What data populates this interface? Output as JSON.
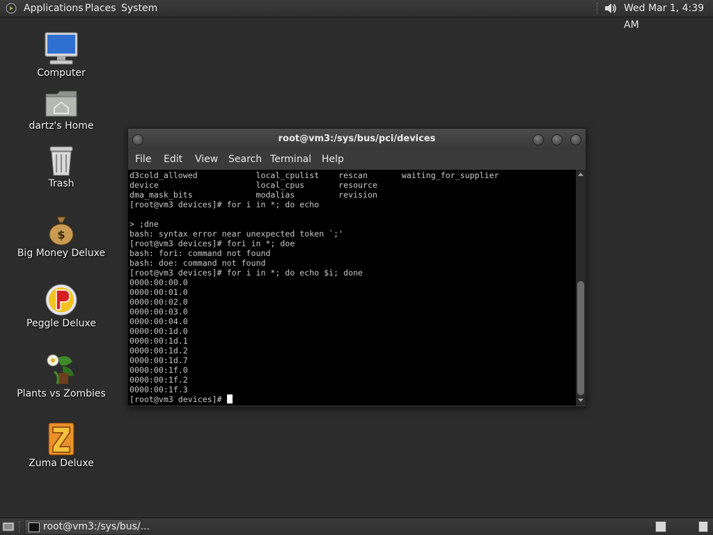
{
  "top_panel": {
    "applications_label": "Applications",
    "places_label": "Places",
    "system_label": "System",
    "clock": "Wed Mar 1,  4:39 AM"
  },
  "desktop": {
    "icons": [
      {
        "label": "Computer",
        "icon": "computer-icon"
      },
      {
        "label": "dartz's Home",
        "icon": "home-folder-icon"
      },
      {
        "label": "Trash",
        "icon": "trash-icon"
      },
      {
        "label": "Big Money Deluxe",
        "icon": "money-bag-icon"
      },
      {
        "label": "Peggle Deluxe",
        "icon": "peggle-icon"
      },
      {
        "label": "Plants vs Zombies",
        "icon": "plants-vs-zombies-icon"
      },
      {
        "label": "Zuma Deluxe",
        "icon": "zuma-icon"
      }
    ]
  },
  "terminal": {
    "title": "root@vm3:/sys/bus/pci/devices",
    "menu": {
      "file": "File",
      "edit": "Edit",
      "view": "View",
      "search": "Search",
      "terminal": "Terminal",
      "help": "Help"
    },
    "lines": [
      "d3cold_allowed            local_cpulist    rescan       waiting_for_supplier",
      "device                    local_cpus       resource",
      "dma_mask_bits             modalias         revision",
      "[root@vm3 devices]# for i in *; do echo",
      "",
      "> ;dne",
      "bash: syntax error near unexpected token `;'",
      "[root@vm3 devices]# fori in *; doe",
      "bash: fori: command not found",
      "bash: doe: command not found",
      "[root@vm3 devices]# for i in *; do echo $i; done",
      "0000:00:00.0",
      "0000:00:01.0",
      "0000:00:02.0",
      "0000:00:03.0",
      "0000:00:04.0",
      "0000:00:1d.0",
      "0000:00:1d.1",
      "0000:00:1d.2",
      "0000:00:1d.7",
      "0000:00:1f.0",
      "0000:00:1f.2",
      "0000:00:1f.3"
    ],
    "prompt": "[root@vm3 devices]# "
  },
  "taskbar": {
    "task_label": "root@vm3:/sys/bus/..."
  }
}
